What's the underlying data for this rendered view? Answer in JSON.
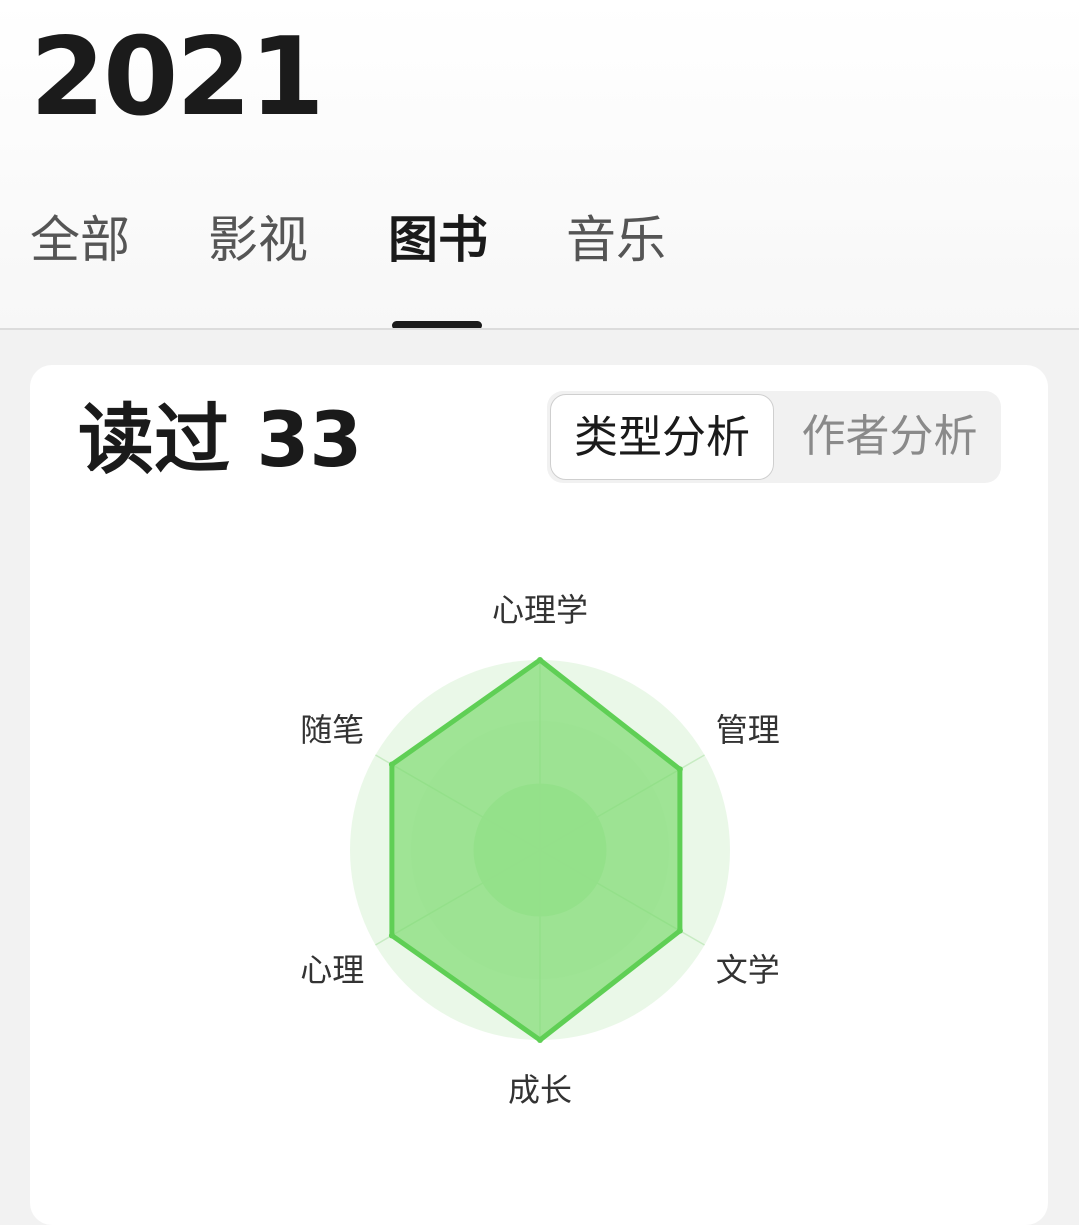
{
  "header": {
    "year": "2021"
  },
  "tabs": [
    {
      "label": "全部",
      "active": false
    },
    {
      "label": "影视",
      "active": false
    },
    {
      "label": "图书",
      "active": true
    },
    {
      "label": "音乐",
      "active": false
    }
  ],
  "card": {
    "read_count_label": "读过 33",
    "segments": {
      "type_analysis": "类型分析",
      "author_analysis": "作者分析",
      "selected": "类型分析"
    }
  },
  "chart_data": {
    "type": "radar",
    "axes": [
      "心理学",
      "管理",
      "文学",
      "成长",
      "心理",
      "随笔"
    ],
    "values": [
      1.0,
      0.85,
      0.85,
      1.0,
      0.9,
      0.9
    ],
    "range": [
      0,
      1
    ],
    "colors": {
      "fill": "#7fdc72",
      "stroke": "#5fcf55",
      "background": "#d8f3d6"
    }
  }
}
